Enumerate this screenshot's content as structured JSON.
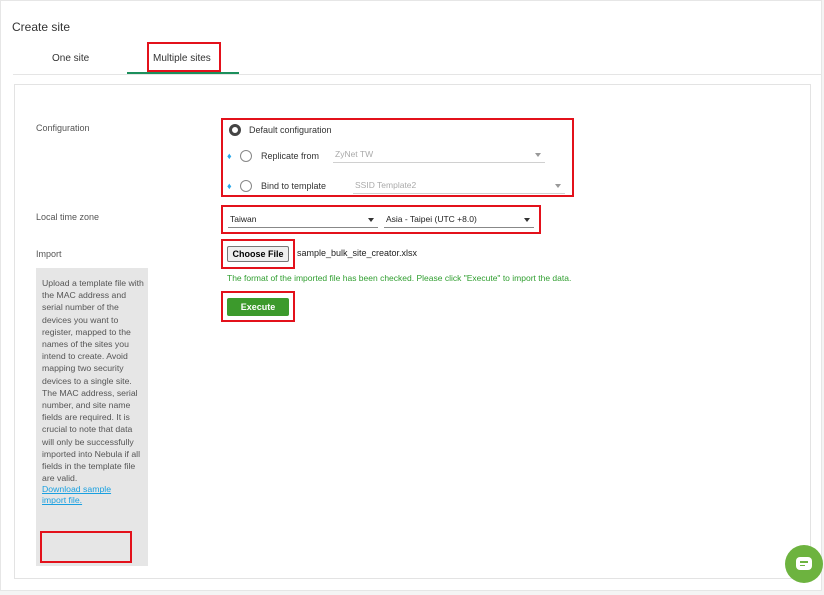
{
  "page": {
    "title": "Create site"
  },
  "tabs": [
    {
      "label": "One site",
      "active": false
    },
    {
      "label": "Multiple sites",
      "active": true
    }
  ],
  "configuration": {
    "label": "Configuration",
    "options": [
      {
        "label": "Default configuration",
        "selected": true
      },
      {
        "label": "Replicate from",
        "select_value": "ZyNet TW",
        "icon": "gem-icon",
        "selected": false
      },
      {
        "label": "Bind to template",
        "select_value": "SSID Template2",
        "icon": "gem-icon",
        "selected": false
      }
    ]
  },
  "timezone": {
    "label": "Local time zone",
    "country": "Taiwan",
    "zone": "Asia - Taipei (UTC +8.0)"
  },
  "import": {
    "label": "Import",
    "choose_file_label": "Choose File",
    "file_name": "sample_bulk_site_creator.xlsx",
    "status_message": "The format of the imported file has been checked. Please click \"Execute\" to import the data.",
    "execute_label": "Execute",
    "help_text": "Upload a template file with the MAC address and serial number of the devices you want to register, mapped to the names of the sites you intend to create. Avoid mapping two security devices to a single site. The MAC address, serial number, and site name fields are required. It is crucial to note that data will only be successfully imported into Nebula if all fields in the template file are valid.",
    "download_link": "Download sample import file."
  },
  "colors": {
    "accent_green": "#3c9a2c",
    "highlight_red": "#e3111b",
    "link_blue": "#1aa0e0",
    "status_green": "#2f9e2f"
  }
}
